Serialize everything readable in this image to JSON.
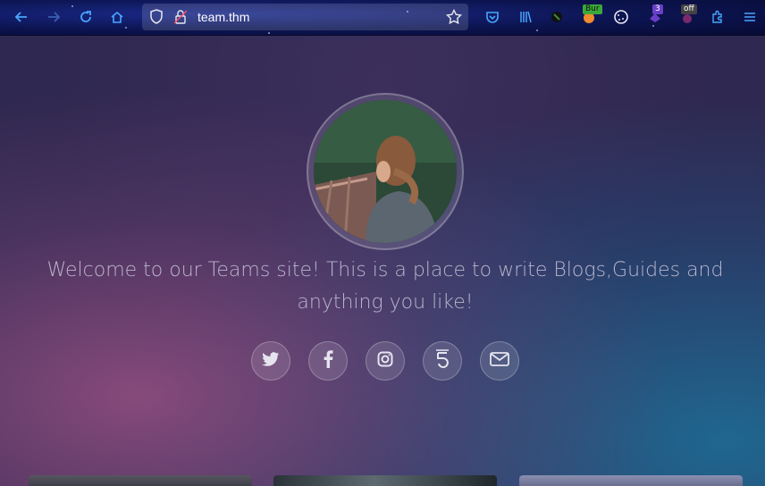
{
  "browser": {
    "url": "team.thm",
    "extensions": {
      "burp_badge": "Bur",
      "counter_badge": "3",
      "off_badge": "off"
    }
  },
  "hero": {
    "welcome_text": "Welcome to our Teams site! This is a place to write Blogs,Guides and anything you like!"
  },
  "social_links": [
    {
      "name": "twitter",
      "glyph": "🐦"
    },
    {
      "name": "facebook",
      "glyph": "f"
    },
    {
      "name": "instagram",
      "glyph": "◎"
    },
    {
      "name": "html5",
      "glyph": "5"
    },
    {
      "name": "email",
      "glyph": "✉"
    }
  ],
  "colors": {
    "toolbar_icon": "#49a6ff",
    "welcome_text": "#b9b5cc"
  }
}
